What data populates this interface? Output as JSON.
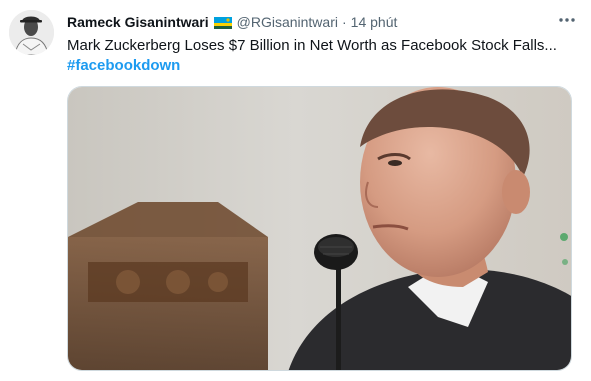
{
  "tweet": {
    "author_name": "Rameck Gisanintwari",
    "handle": "@RGisanintwari",
    "separator": "·",
    "time": "14 phút",
    "text": "Mark Zuckerberg Loses $7 Billion in Net Worth as Facebook Stock Falls...",
    "hashtag": "#facebookdown",
    "more_icon": "more-dots-icon",
    "flag_icon": "rwanda-flag-icon"
  },
  "colors": {
    "link": "#1d9bf0",
    "secondary_text": "#536471",
    "primary_text": "#0f1419",
    "border": "#cfd9de"
  }
}
